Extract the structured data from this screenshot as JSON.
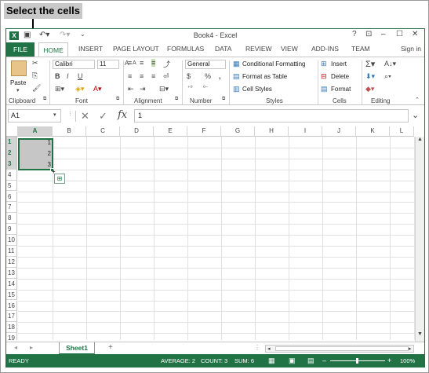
{
  "callout": "Select the cells",
  "window": {
    "title": "Book4 - Excel",
    "help": "?",
    "controls": [
      "⊡",
      "–",
      "☐",
      "✕"
    ]
  },
  "tabs": {
    "file": "FILE",
    "home": "HOME",
    "others": [
      "INSERT",
      "PAGE LAYOUT",
      "FORMULAS",
      "DATA",
      "REVIEW",
      "VIEW",
      "ADD-INS",
      "TEAM"
    ],
    "signin": "Sign in"
  },
  "ribbon": {
    "clipboard": {
      "label": "Clipboard",
      "paste": "Paste"
    },
    "font": {
      "label": "Font",
      "name": "Calibri",
      "size": "11",
      "bold": "B",
      "italic": "I",
      "underline": "U",
      "grow": "A",
      "shrink": "A"
    },
    "alignment": {
      "label": "Alignment"
    },
    "number": {
      "label": "Number",
      "format": "General",
      "currency": "$",
      "percent": "%",
      "comma": ","
    },
    "styles": {
      "label": "Styles",
      "conditional": "Conditional Formatting",
      "table": "Format as Table",
      "cell": "Cell Styles"
    },
    "cells": {
      "label": "Cells",
      "insert": "Insert",
      "delete": "Delete",
      "format": "Format"
    },
    "editing": {
      "label": "Editing"
    }
  },
  "formula_bar": {
    "name_box": "A1",
    "fx": "fx",
    "content": "1"
  },
  "grid": {
    "columns": [
      "A",
      "B",
      "C",
      "D",
      "E",
      "F",
      "G",
      "H",
      "I",
      "J",
      "K",
      "L"
    ],
    "rows": [
      "1",
      "2",
      "3",
      "4",
      "5",
      "6",
      "7",
      "8",
      "9",
      "10",
      "11",
      "12",
      "13",
      "14",
      "15",
      "16",
      "17",
      "18",
      "19"
    ],
    "cells": {
      "A1": "1",
      "A2": "2",
      "A3": "3"
    }
  },
  "sheets": {
    "active": "Sheet1",
    "add": "+"
  },
  "status": {
    "mode": "READY",
    "average": "AVERAGE: 2",
    "count": "COUNT: 3",
    "sum": "SUM: 6",
    "zoom": "100%"
  },
  "colors": {
    "accent": "#217346",
    "selection": "#c6c6c6"
  }
}
